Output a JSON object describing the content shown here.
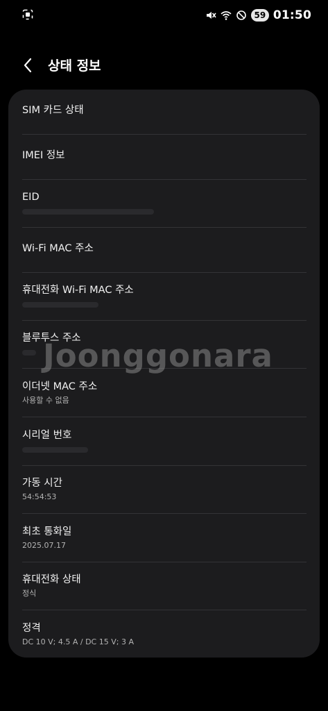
{
  "status_bar": {
    "battery": "59",
    "time": "01:50"
  },
  "header": {
    "title": "상태 정보"
  },
  "items": [
    {
      "title": "SIM 카드 상태"
    },
    {
      "title": "IMEI 정보"
    },
    {
      "title": "EID",
      "sub": ""
    },
    {
      "title": "Wi-Fi MAC 주소"
    },
    {
      "title": "휴대전화 Wi-Fi MAC 주소",
      "sub": ""
    },
    {
      "title": "블루투스 주소",
      "sub": ""
    },
    {
      "title": "이더넷 MAC 주소",
      "sub": "사용할 수 없음"
    },
    {
      "title": "시리얼 번호",
      "sub": ""
    },
    {
      "title": "가동 시간",
      "sub": "54:54:53"
    },
    {
      "title": "최초 통화일",
      "sub": "2025.07.17"
    },
    {
      "title": "휴대전화 상태",
      "sub": "정식"
    },
    {
      "title": "정격",
      "sub": "DC 10 V; 4.5 A / DC 15 V; 3 A"
    }
  ],
  "watermark": {
    "text": "Joonggonara"
  },
  "colors": {
    "background": "#000000",
    "card": "#1c1c1e",
    "divider": "#333336",
    "subtext": "#b3b3b3"
  }
}
